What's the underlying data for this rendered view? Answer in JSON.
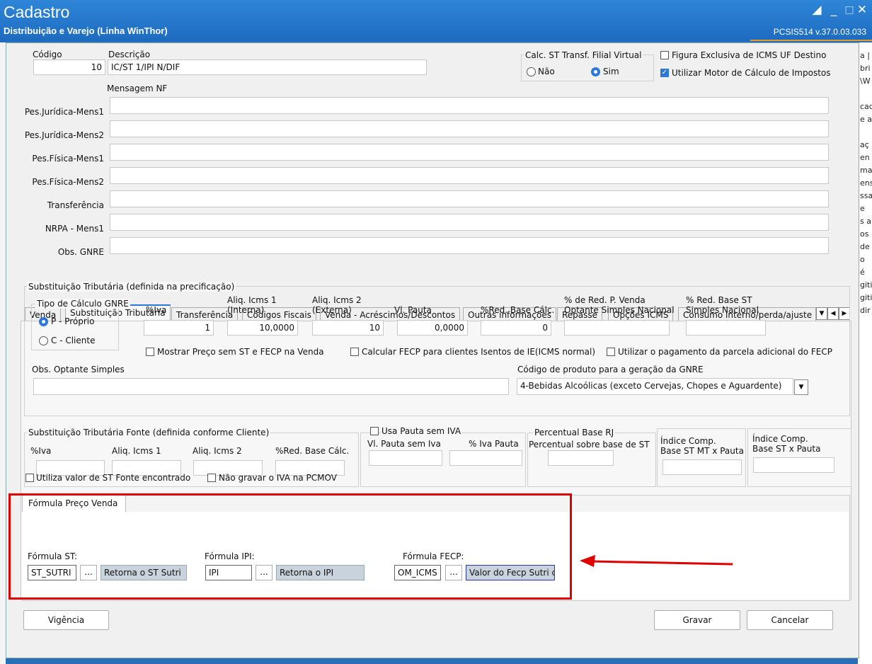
{
  "titlebar": {
    "title": "Cadastro",
    "subtitle": "Distribuição e Varejo (Linha WinThor)",
    "version": "PCSIS514  v.37.0.03.033"
  },
  "header": {
    "codigo_label": "Código",
    "codigo_value": "10",
    "descricao_label": "Descrição",
    "descricao_value": "IC/ST 1/IPI N/DIF",
    "calc_st_label": "Calc. ST Transf. Filial Virtual",
    "nao": "Não",
    "sim": "Sim",
    "figura_exclusiva": "Figura Exclusiva de ICMS UF Destino",
    "utilizar_motor": "Utilizar Motor de Cálculo de Impostos",
    "mensagem_nf": "Mensagem NF"
  },
  "mensagens": [
    {
      "label": "Pes.Jurídica-Mens1",
      "value": ""
    },
    {
      "label": "Pes.Jurídica-Mens2",
      "value": ""
    },
    {
      "label": "Pes.Física-Mens1",
      "value": ""
    },
    {
      "label": "Pes.Física-Mens2",
      "value": ""
    },
    {
      "label": "Transferência",
      "value": ""
    },
    {
      "label": "NRPA - Mens1",
      "value": ""
    },
    {
      "label": "Obs. GNRE",
      "value": ""
    }
  ],
  "tabs": [
    "Venda",
    "Substituição Tributária",
    "Transferência",
    "Códigos Fiscais",
    "Venda - Acréscimos/Descontos",
    "Outras informações",
    "Repasse",
    "Opções ICMS",
    "Consumo interno/perda/ajuste"
  ],
  "st": {
    "group_title": "Substituição Tributária (definida na precificação)",
    "tipo_calc": "Tipo de Cálculo GNRE",
    "proprio": "P - Próprio",
    "cliente": "C - Cliente",
    "iva_label": "%Iva",
    "iva": "1",
    "aliq1_label1": "Aliq. Icms 1",
    "aliq1_label2": "(Interna)",
    "aliq1": "10,0000",
    "aliq2_label1": "Aliq. Icms 2",
    "aliq2_label2": "(Externa)",
    "aliq2": "10",
    "pauta_label": "Vl. Pauta",
    "pauta": "0,0000",
    "redbase_label": "%Red. Base Cálc.",
    "redbase": "0",
    "redvenda_label1": "% de Red. P. Venda",
    "redvenda_label2": "Optante Simples Nacional",
    "redvenda": "",
    "redst_label1": "% Red. Base ST",
    "redst_label2": "Simples Nacional",
    "redst": "",
    "mostrar_preco": "Mostrar Preço sem ST e FECP na Venda",
    "calcular_fecp": "Calcular FECP para clientes Isentos de IE(ICMS normal)",
    "utilizar_pagamento": "Utilizar o pagamento da parcela adicional do FECP",
    "obs_optante": "Obs. Optante Simples",
    "obs_value": "",
    "codigo_produto_label": "Código de produto para a geração da GNRE",
    "codigo_produto": "4-Bebidas Alcoólicas (exceto Cervejas, Chopes e Aguardente)"
  },
  "fonte": {
    "group_title": "Substituição Tributária Fonte (definida conforme Cliente)",
    "iva": "%Iva",
    "aliq1": "Aliq. Icms 1",
    "aliq2": "Aliq. Icms 2",
    "redbase": "%Red. Base Cálc.",
    "utiliza_valor": "Utiliza valor de ST Fonte encontrado",
    "nao_gravar": "Não gravar o IVA na PCMOV"
  },
  "pauta": {
    "usa_pauta": "Usa Pauta sem IVA",
    "vl_pauta": "Vl. Pauta sem Iva",
    "iva_pauta": "% Iva Pauta"
  },
  "percentual": {
    "title": "Percentual Base RJ",
    "label": "Percentual sobre base de ST"
  },
  "indice_mt": {
    "l1": "Índice Comp.",
    "l2": "Base ST MT x Pauta"
  },
  "indice": {
    "l1": "Índice Comp.",
    "l2": "Base ST x Pauta"
  },
  "formula": {
    "tab": "Fórmula Preço Venda",
    "st_label": "Fórmula ST:",
    "st_code": "ST_SUTRI",
    "st_desc": "Retorna o ST Sutri",
    "ipi_label": "Fórmula IPI:",
    "ipi_code": "IPI",
    "ipi_desc": "Retorna o IPI",
    "fecp_label": "Fórmula FECP:",
    "fecp_code": "OM_ICMS",
    "fecp_desc": "Valor do Fecp Sutri c",
    "ellipsis": "..."
  },
  "footer": {
    "vigencia": "Vigência",
    "gravar": "Gravar",
    "cancelar": "Cancelar"
  },
  "background_right": [
    "a |",
    "bri",
    "\\W",
    "",
    "cad",
    "e a",
    "",
    "aç",
    "en",
    "ma",
    "ens",
    "ssa",
    "e",
    "s a",
    "os",
    "de",
    "o",
    "é",
    "giti",
    "giti",
    "dir"
  ],
  "colors": {
    "accent": "#2b78d8",
    "highlight": "#e00000",
    "titlebar": "#1d6bc0"
  }
}
